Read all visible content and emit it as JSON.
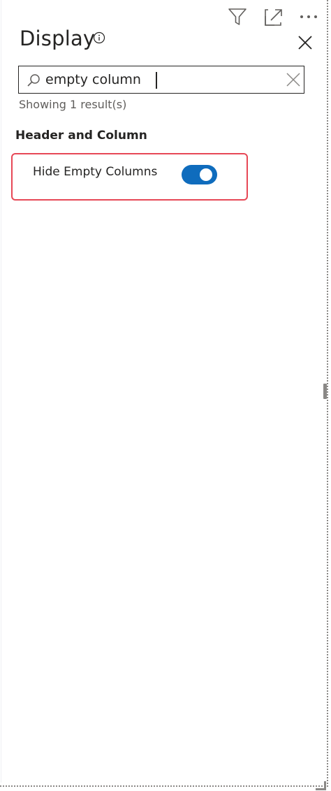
{
  "pane": {
    "title": "Display",
    "toolbar_icons": [
      "filter-icon",
      "expand-icon",
      "more-options-icon"
    ],
    "info_icon": "info-icon",
    "close_icon": "close-icon"
  },
  "search": {
    "value": "empty column",
    "search_icon": "search-icon",
    "clear_icon": "clear-icon"
  },
  "results_text": "Showing 1 result(s)",
  "section": {
    "title": "Header and Column",
    "settings": [
      {
        "label": "Hide Empty Columns",
        "enabled": true
      }
    ]
  },
  "colors": {
    "toggle_on": "#0f6cbd",
    "highlight_border": "#e74856",
    "text_primary": "#252423",
    "text_secondary": "#605e5c"
  }
}
